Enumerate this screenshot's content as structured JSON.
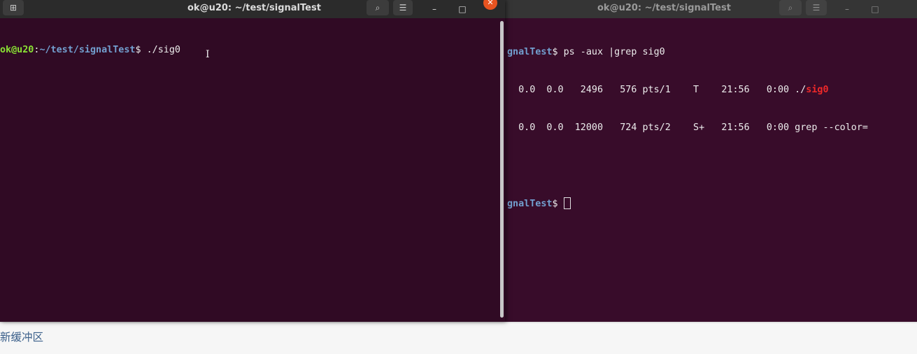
{
  "left_window": {
    "title": "ok@u20: ~/test/signalTest",
    "new_tab_label": "⊞",
    "search_label": "⌕",
    "menu_label": "☰",
    "minimize_label": "–",
    "maximize_label": "□",
    "close_label": "✕",
    "prompt_user": "ok@u20",
    "prompt_colon": ":",
    "prompt_path": "~/test/signalTest",
    "prompt_symbol": "$ ",
    "command": "./sig0"
  },
  "right_window": {
    "title": "ok@u20: ~/test/signalTest",
    "search_label": "⌕",
    "menu_label": "☰",
    "minimize_label": "–",
    "maximize_label": "□",
    "prompt_path": "gnalTest",
    "prompt_symbol": "$ ",
    "command": "ps -aux |grep sig0",
    "rows": [
      {
        "pre": "  0.0  0.0   2496   576 pts/1    T    21:56   0:00 ./",
        "highlight": "sig0",
        "post": ""
      },
      {
        "pre": "  0.0  0.0  12000   724 pts/2    S+   21:56   0:00 grep --color=",
        "highlight": "",
        "post": ""
      }
    ]
  },
  "bottom_bar": {
    "text": "新缓冲区"
  }
}
